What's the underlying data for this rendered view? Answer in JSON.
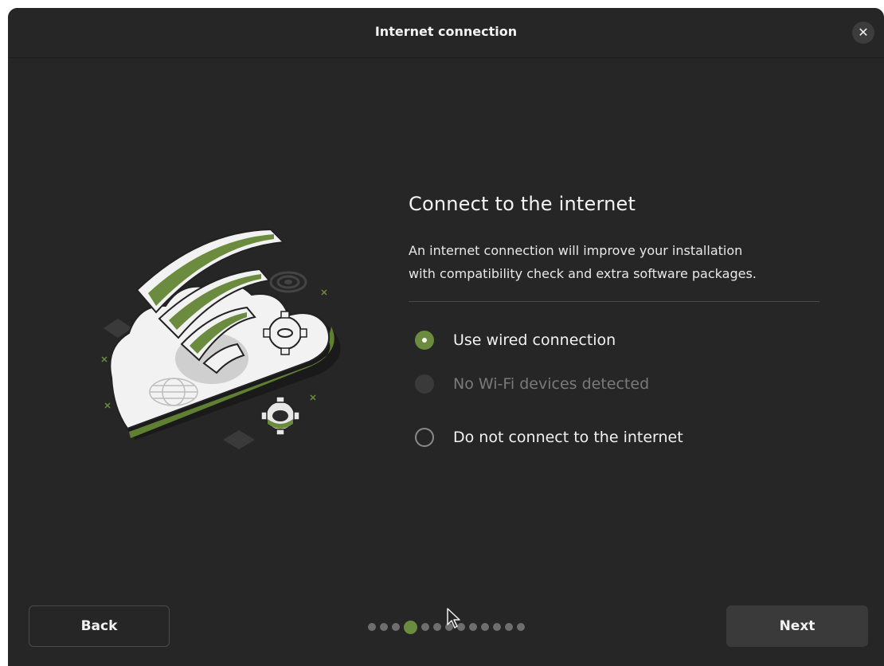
{
  "window": {
    "title": "Internet connection",
    "close_icon": "close-icon"
  },
  "main": {
    "heading": "Connect to the internet",
    "description_line1": "An internet connection will improve your installation",
    "description_line2": "with compatibility check and extra software packages.",
    "options": [
      {
        "label": "Use wired connection",
        "selected": true,
        "enabled": true
      },
      {
        "label": "No Wi-Fi devices detected",
        "selected": false,
        "enabled": false
      },
      {
        "label": "Do not connect to the internet",
        "selected": false,
        "enabled": true
      }
    ]
  },
  "footer": {
    "back_label": "Back",
    "next_label": "Next",
    "pager": {
      "total": 13,
      "current": 4
    }
  },
  "colors": {
    "accent": "#6b8b3e",
    "background": "#262626",
    "button": "#3a3a3a"
  }
}
